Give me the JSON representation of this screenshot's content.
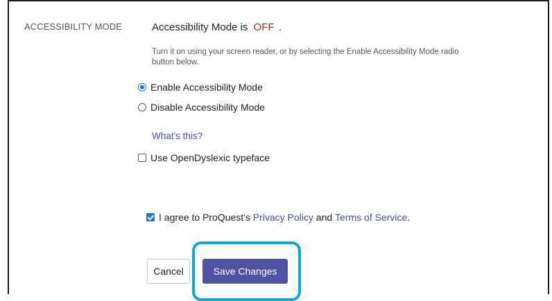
{
  "section": {
    "label": "ACCESSIBILITY MODE"
  },
  "status": {
    "prefix": "Accessibility Mode is",
    "value": "OFF",
    "suffix": "."
  },
  "help_text": "Turn it on using your screen reader, or by selecting the Enable Accessibility Mode radio button below.",
  "options": {
    "enable": {
      "label": "Enable Accessibility Mode",
      "selected": true
    },
    "disable": {
      "label": "Disable Accessibility Mode",
      "selected": false
    }
  },
  "whats_this": "What's this?",
  "dyslexic": {
    "label": "Use OpenDyslexic typeface",
    "checked": false
  },
  "agree": {
    "checked": true,
    "prefix": "I agree to ProQuest's",
    "privacy_link": "Privacy Policy",
    "and": "and",
    "terms_link": "Terms of Service",
    "suffix": "."
  },
  "buttons": {
    "cancel": "Cancel",
    "save": "Save Changes"
  },
  "colors": {
    "status_off": "#b3261e",
    "link": "#4b4c9a",
    "primary_button": "#4f51a3",
    "focus_ring": "#0fa6e0",
    "control_accent": "#1a73e8"
  }
}
